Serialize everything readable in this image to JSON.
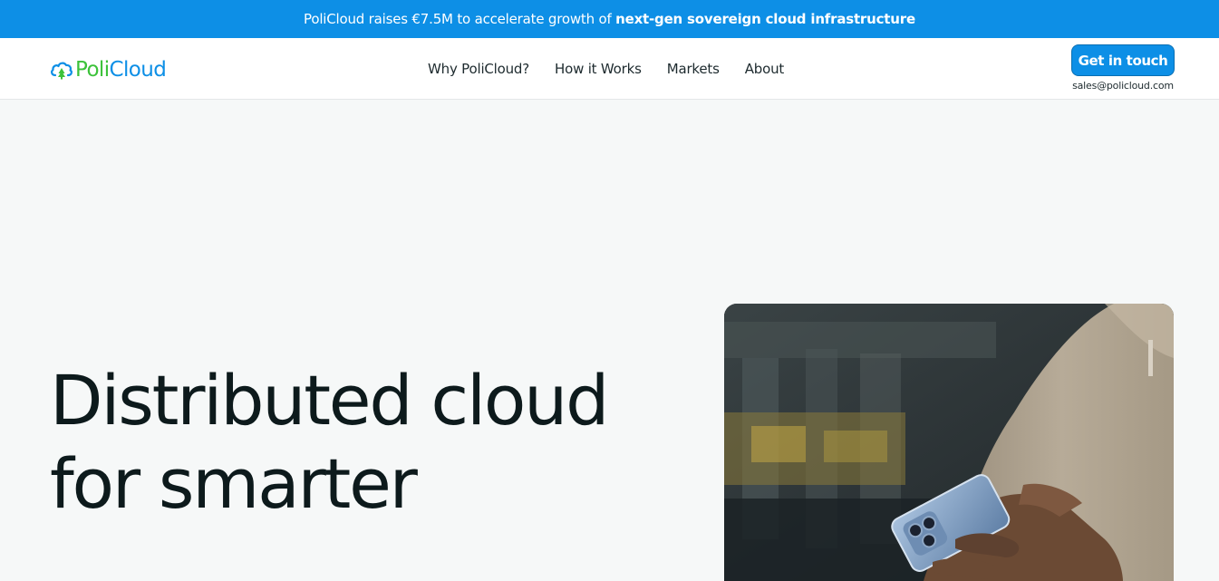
{
  "announcement": {
    "text": "PoliCloud raises €7.5M to accelerate growth of",
    "highlight": "next-gen sovereign cloud infrastructure"
  },
  "brand": {
    "name_part1": "Poli",
    "name_part2": "Cloud",
    "logo_icon": "cloud-tree-icon",
    "colors": {
      "green": "#3cc23a",
      "blue": "#0d8fe6"
    }
  },
  "nav": {
    "items": [
      {
        "label": "Why PoliCloud?"
      },
      {
        "label": "How it Works"
      },
      {
        "label": "Markets"
      },
      {
        "label": "About"
      }
    ]
  },
  "cta": {
    "label": "Get in touch",
    "email": "sales@policloud.com"
  },
  "hero": {
    "line1": "Distributed cloud",
    "line2": "for smarter"
  },
  "colors": {
    "accent": "#0d8fe6",
    "heading": "#0d1a1c",
    "page_bg": "#f6f8f8"
  }
}
